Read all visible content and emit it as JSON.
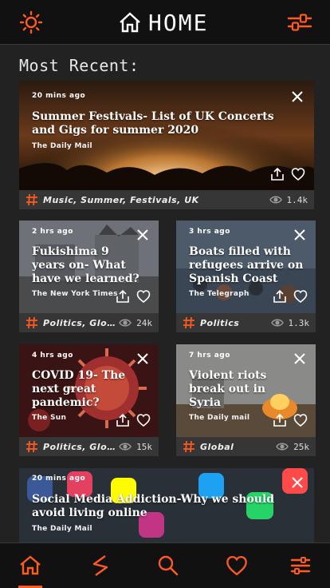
{
  "header": {
    "title": "HOME",
    "left_icon": "settings-sun-icon",
    "right_icon": "filter-sliders-icon"
  },
  "section_title": "Most Recent:",
  "accent_color": "#ff5a1f",
  "articles": [
    {
      "time": "20 mins ago",
      "headline": "Summer Festivals- List of UK Concerts and Gigs for summer 2020",
      "source": "The Daily Mail",
      "tags": "Music, Summer, Festivals, UK",
      "views": "1.4k"
    },
    {
      "time": "2 hrs ago",
      "headline": "Fukishima 9 years on- What have we learned?",
      "source": "The New York Times",
      "tags": "Politics, Global...",
      "views": "24k"
    },
    {
      "time": "3 hrs ago",
      "headline": "Boats filled with refugees arrive on Spanish Coast",
      "source": "The Telegraph",
      "tags": "Politics",
      "views": "1.3k"
    },
    {
      "time": "4 hrs ago",
      "headline": "COVID 19- The next great pandemic?",
      "source": "The Sun",
      "tags": "Politics, Global...",
      "views": "15k"
    },
    {
      "time": "7 hrs ago",
      "headline": "Violent riots break out in Syria",
      "source": "The Daily mail",
      "tags": "Global",
      "views": "25k"
    },
    {
      "time": "20 mins ago",
      "headline": "Social Media Addiction-Why we should avoid living online",
      "source": "The Daily Mail"
    }
  ],
  "bottom_nav": [
    {
      "icon": "home-icon",
      "active": true
    },
    {
      "icon": "trending-icon",
      "active": false
    },
    {
      "icon": "search-icon",
      "active": false
    },
    {
      "icon": "heart-icon",
      "active": false
    },
    {
      "icon": "menu-icon",
      "active": false
    }
  ]
}
